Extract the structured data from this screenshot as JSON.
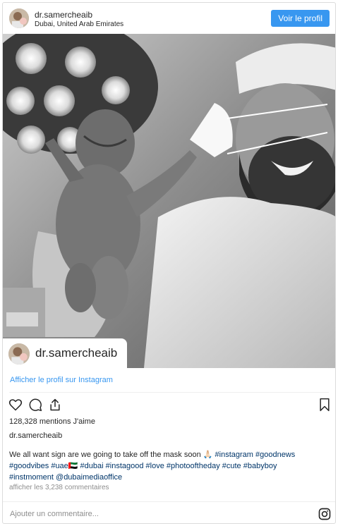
{
  "header": {
    "username": "dr.samercheaib",
    "location": "Dubai, United Arab Emirates",
    "profile_button": "Voir le profil"
  },
  "photo_overlay": {
    "username": "dr.samercheaib"
  },
  "view_profile_link": "Afficher le profil sur Instagram",
  "actions": {
    "like_icon": "heart-icon",
    "comment_icon": "comment-icon",
    "share_icon": "share-icon",
    "save_icon": "bookmark-icon"
  },
  "likes": "128,328 mentions J'aime",
  "caption": {
    "username": "dr.samercheaib",
    "text": "We all want sign are we going to take off the mask soon 🙏🏻",
    "hashtags_line1": "#instagram #goodnews",
    "hashtags_line2": "#goodvibes #uae🇦🇪 #dubai #instagood #love #photooftheday #cute #babyboy",
    "hashtags_line3": "#instmoment @dubaimediaoffice"
  },
  "comments_link": "afficher les 3,238 commentaires",
  "comment_box": {
    "placeholder": "Ajouter un commentaire...",
    "icon": "instagram-icon"
  }
}
